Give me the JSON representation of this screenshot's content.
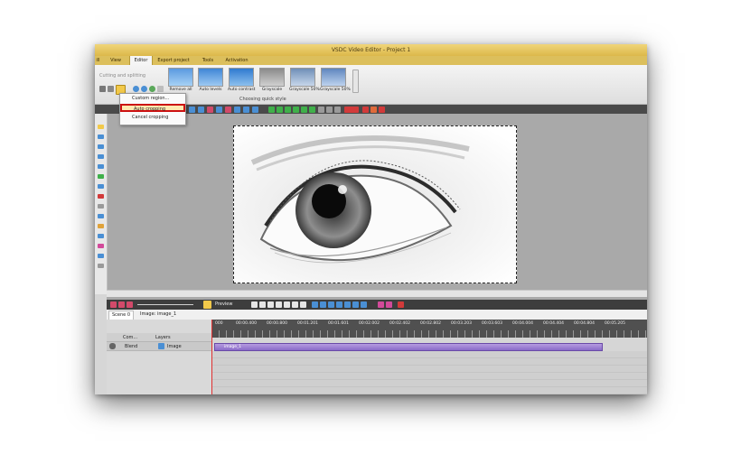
{
  "window": {
    "title": "VSDC Video Editor - Project 1"
  },
  "menu": {
    "items": [
      "ill",
      "View",
      "Editor",
      "Export project",
      "Tools",
      "Activation"
    ],
    "active": "Editor"
  },
  "ribbon": {
    "cutting_label": "Cutting and splitting",
    "quick_style_caption": "Choosing quick style",
    "effects": [
      "Remove all",
      "Auto levels",
      "Auto contrast",
      "Grayscale",
      "Grayscale 50%",
      "Grayscale 50%"
    ]
  },
  "crop_menu": {
    "items": [
      "Custom region...",
      "Auto cropping",
      "Cancel cropping"
    ],
    "selected": "Auto cropping"
  },
  "timeline": {
    "preview_label": "Preview",
    "tabs": [
      "Scene 0",
      "Image: image_1"
    ],
    "ruler": [
      "000",
      "00:00.400",
      "00:00.800",
      "00:01.201",
      "00:01.601",
      "00:02.002",
      "00:02.402",
      "00:02.802",
      "00:03.203",
      "00:03.603",
      "00:04.004",
      "00:04.404",
      "00:04.804",
      "00:05.205"
    ],
    "track_header": {
      "com": "Com...",
      "layers": "Layers"
    },
    "track": {
      "blend": "Blend",
      "name": "Image",
      "clip": "image_1"
    }
  },
  "colors": {
    "accent": "#dcb84a",
    "selection": "#cc1111",
    "clip": "#8a6ac8"
  }
}
